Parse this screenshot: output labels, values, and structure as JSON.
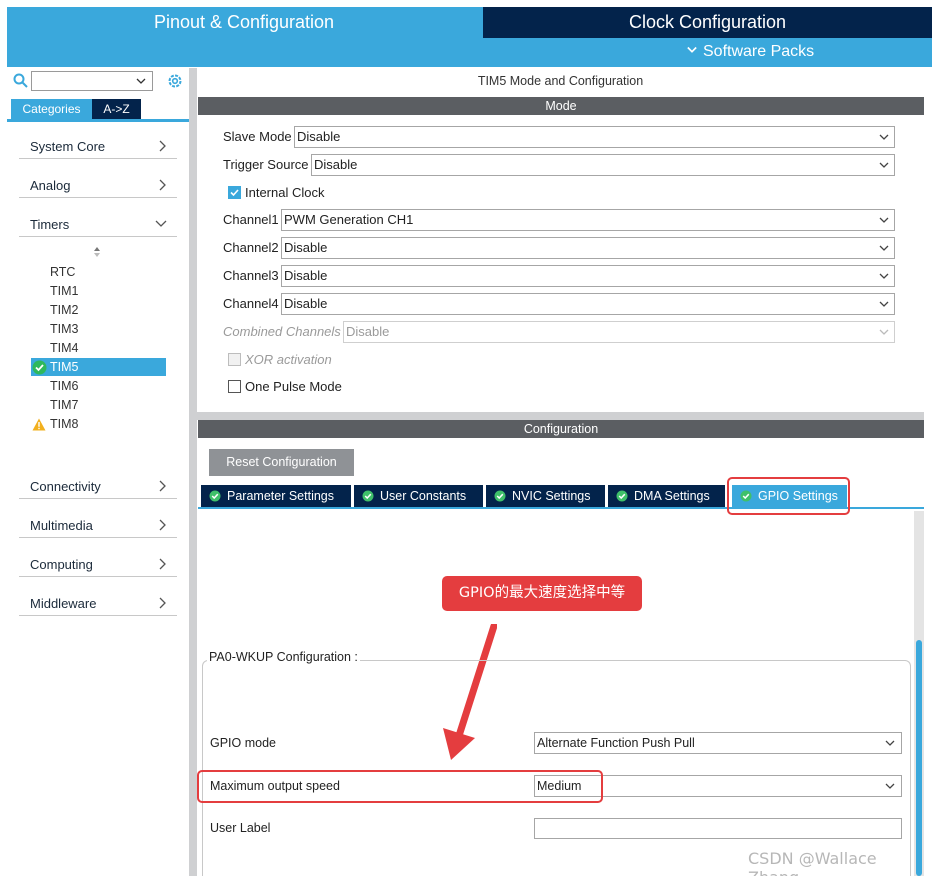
{
  "header": {
    "pinout_tab": "Pinout & Configuration",
    "clock_tab": "Clock Configuration",
    "software_packs": "Software Packs"
  },
  "left_panel": {
    "search_placeholder": "",
    "tabs": {
      "categories": "Categories",
      "az": "A->Z"
    },
    "categories": [
      {
        "label": "System Core"
      },
      {
        "label": "Analog"
      },
      {
        "label": "Timers"
      },
      {
        "label": "Connectivity"
      },
      {
        "label": "Multimedia"
      },
      {
        "label": "Computing"
      },
      {
        "label": "Middleware"
      }
    ],
    "timers": [
      "RTC",
      "TIM1",
      "TIM2",
      "TIM3",
      "TIM4",
      "TIM5",
      "TIM6",
      "TIM7",
      "TIM8"
    ]
  },
  "mode": {
    "title": "TIM5 Mode and Configuration",
    "section": "Mode",
    "slave_mode": {
      "label": "Slave Mode",
      "value": "Disable"
    },
    "trigger_source": {
      "label": "Trigger Source",
      "value": "Disable"
    },
    "internal_clock": {
      "label": "Internal Clock",
      "checked": true
    },
    "channels": [
      {
        "label": "Channel1",
        "value": "PWM Generation CH1"
      },
      {
        "label": "Channel2",
        "value": "Disable"
      },
      {
        "label": "Channel3",
        "value": "Disable"
      },
      {
        "label": "Channel4",
        "value": "Disable"
      }
    ],
    "combined_channels": {
      "label": "Combined Channels",
      "value": "Disable"
    },
    "xor_activation": {
      "label": "XOR activation",
      "checked": false
    },
    "one_pulse_mode": {
      "label": "One Pulse Mode",
      "checked": false
    }
  },
  "configuration": {
    "section": "Configuration",
    "reset_button": "Reset Configuration",
    "tabs": [
      "Parameter Settings",
      "User Constants",
      "NVIC Settings",
      "DMA Settings",
      "GPIO Settings"
    ],
    "active_tab": "GPIO Settings",
    "annotation": "GPIO的最大速度选择中等",
    "group_title": "PA0-WKUP Configuration :",
    "gpio_mode": {
      "label": "GPIO mode",
      "value": "Alternate Function Push Pull"
    },
    "max_speed": {
      "label": "Maximum output speed",
      "value": "Medium"
    },
    "user_label": {
      "label": "User Label",
      "value": ""
    }
  },
  "watermark": "CSDN @Wallace Zhang",
  "colors": {
    "accent": "#3aa8dc",
    "dark_navy": "#03234b",
    "bar_gray": "#5b5e62",
    "annotation_red": "#e43d3f"
  }
}
